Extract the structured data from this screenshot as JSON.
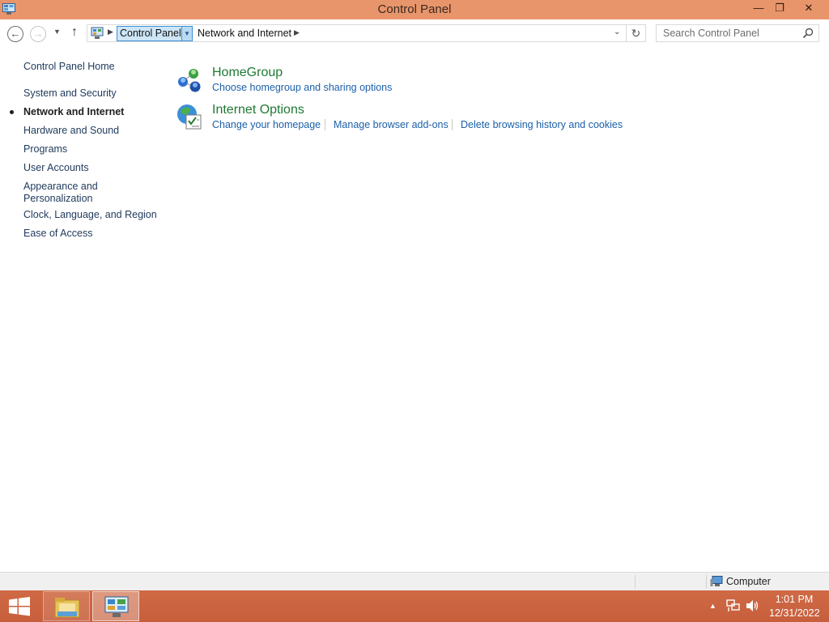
{
  "window": {
    "title": "Control Panel",
    "minimize_glyph": "—",
    "maximize_glyph": "❐",
    "close_glyph": "✕"
  },
  "addressbar": {
    "back_glyph": "←",
    "forward_glyph": "→",
    "recent_glyph": "▼",
    "up_glyph": "↑",
    "crumbs": [
      "Control Panel",
      "Network and Internet"
    ],
    "separator_glyph": "▶",
    "dropdown_glyph": "▼",
    "addr_dropdown_glyph": "⌄",
    "refresh_glyph": "↻"
  },
  "search": {
    "placeholder": "Search Control Panel"
  },
  "sidebar": {
    "home": "Control Panel Home",
    "items": [
      {
        "label": "System and Security"
      },
      {
        "label": "Network and Internet",
        "current": true
      },
      {
        "label": "Hardware and Sound"
      },
      {
        "label": "Programs"
      },
      {
        "label": "User Accounts"
      },
      {
        "label": "Appearance and",
        "label2": "Personalization"
      },
      {
        "label": "Clock, Language, and Region"
      },
      {
        "label": "Ease of Access"
      }
    ]
  },
  "categories": [
    {
      "title": "HomeGroup",
      "icon": "homegroup-icon",
      "links": [
        "Choose homegroup and sharing options"
      ]
    },
    {
      "title": "Internet Options",
      "icon": "internet-options-icon",
      "links": [
        "Change your homepage",
        "Manage browser add-ons",
        "Delete browsing history and cookies"
      ]
    }
  ],
  "statusbar": {
    "zone": "Computer"
  },
  "taskbar": {
    "tray_arrow_glyph": "▲",
    "time": "1:01 PM",
    "date": "12/31/2022"
  },
  "colors": {
    "titlebar": "#e8956b",
    "taskbar": "#cf6a45",
    "category_title": "#1e7a34",
    "link": "#1b5fa8",
    "nav_link": "#1e395b"
  }
}
